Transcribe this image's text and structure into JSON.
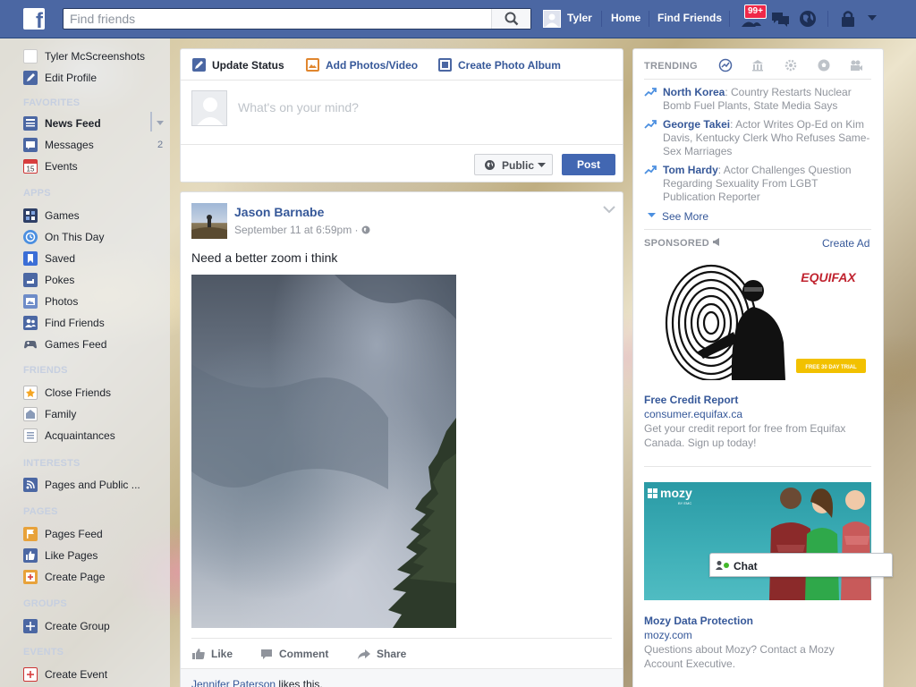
{
  "topbar": {
    "search_placeholder": "Find friends",
    "user_name": "Tyler",
    "home_label": "Home",
    "find_friends_label": "Find Friends",
    "notifications_count": "99+",
    "brand_color": "#4b67a3"
  },
  "sidebar": {
    "profile_name": "Tyler McScreenshots",
    "edit_profile": "Edit Profile",
    "favorites_header": "FAVORITES",
    "news_feed": "News Feed",
    "messages": "Messages",
    "messages_count": "2",
    "events": "Events",
    "apps_header": "APPS",
    "games": "Games",
    "on_this_day": "On This Day",
    "saved": "Saved",
    "pokes": "Pokes",
    "photos": "Photos",
    "find_friends": "Find Friends",
    "games_feed": "Games Feed",
    "friends_header": "FRIENDS",
    "close_friends": "Close Friends",
    "family": "Family",
    "acquaintances": "Acquaintances",
    "interests_header": "INTERESTS",
    "pages_public": "Pages and Public ...",
    "pages_header": "PAGES",
    "pages_feed": "Pages Feed",
    "like_pages": "Like Pages",
    "create_page": "Create Page",
    "groups_header": "GROUPS",
    "create_group": "Create Group",
    "events_header": "EVENTS",
    "create_event": "Create Event"
  },
  "composer": {
    "tab_status": "Update Status",
    "tab_photos": "Add Photos/Video",
    "tab_album": "Create Photo Album",
    "placeholder": "What's on your mind?",
    "privacy": "Public",
    "post_button": "Post"
  },
  "post": {
    "author": "Jason Barnabe",
    "timestamp": "September 11 at 6:59pm · ",
    "text": "Need a better zoom i think",
    "like": "Like",
    "comment": "Comment",
    "share": "Share",
    "liker": "Jennifer Paterson",
    "likes_suffix": " likes this."
  },
  "trending": {
    "header": "TRENDING",
    "items": [
      {
        "topic": "North Korea",
        "desc": ": Country Restarts Nuclear Bomb Fuel Plants, State Media Says"
      },
      {
        "topic": "George Takei",
        "desc": ": Actor Writes Op-Ed on Kim Davis, Kentucky Clerk Who Refuses Same-Sex Marriages"
      },
      {
        "topic": "Tom Hardy",
        "desc": ": Actor Challenges Question Regarding Sexuality From LGBT Publication Reporter"
      }
    ],
    "see_more": "See More"
  },
  "sponsored": {
    "header": "SPONSORED",
    "create_ad": "Create Ad",
    "ads": [
      {
        "brand": "EQUIFAX",
        "badge": "FREE 30 DAY TRIAL",
        "title": "Free Credit Report",
        "url": "consumer.equifax.ca",
        "desc": "Get your credit report for free from Equifax Canada. Sign up today!"
      },
      {
        "brand": "mozy",
        "brand_sub": "BY EMC",
        "title": "Mozy Data Protection",
        "url": "mozy.com",
        "desc": "Questions about Mozy? Contact a Mozy Account Executive."
      }
    ]
  },
  "chat": {
    "label": "Chat"
  }
}
